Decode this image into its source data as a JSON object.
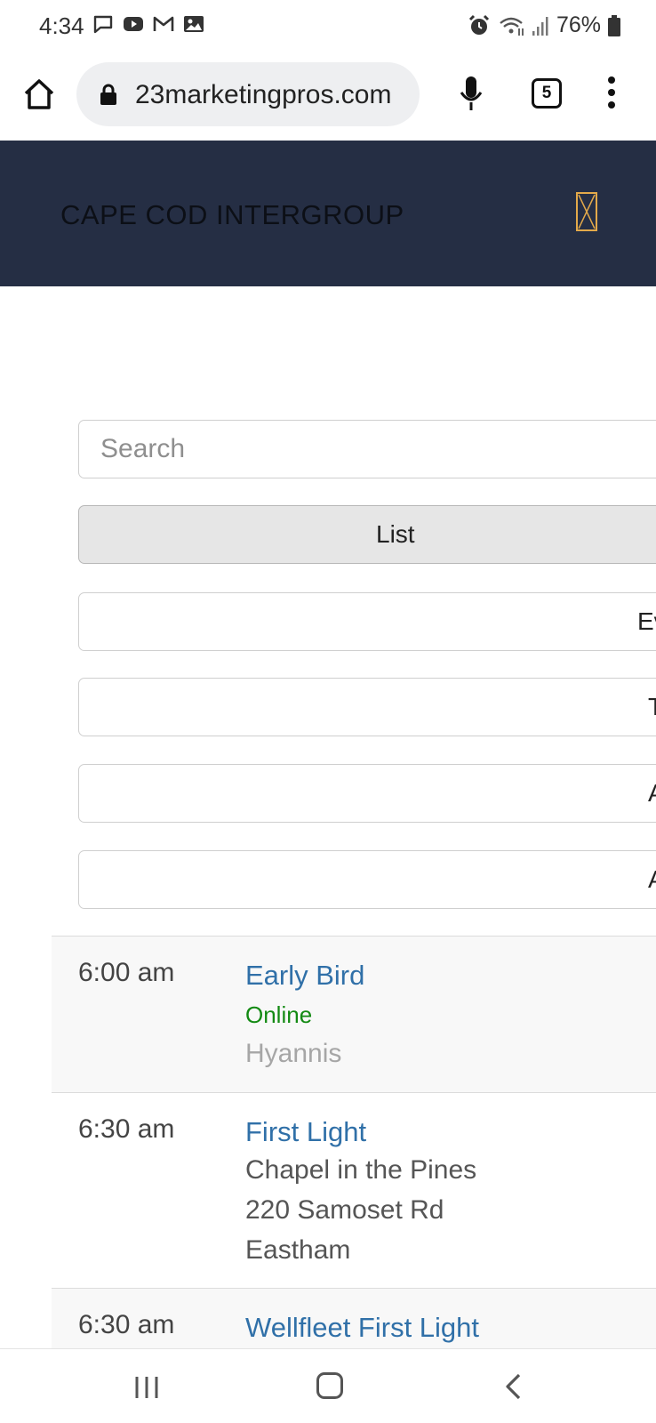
{
  "status_bar": {
    "time": "4:34",
    "battery": "76%",
    "left_icons": [
      "message-icon",
      "youtube-icon",
      "gmail-icon",
      "gallery-icon"
    ],
    "right_icons": [
      "alarm-icon",
      "wifi-icon",
      "signal-icon",
      "battery-icon"
    ]
  },
  "browser": {
    "url": "23marketingpros.com",
    "tab_count": "5"
  },
  "site": {
    "title": "CAPE COD INTERGROUP",
    "brand_color": "#252e44",
    "toggle_color": "#e3a94a"
  },
  "controls": {
    "search_placeholder": "Search",
    "list_label": "List",
    "dropdowns": [
      "Ev",
      "T",
      "A",
      "A"
    ]
  },
  "meetings": [
    {
      "time": "6:00 am",
      "name": "Early Bird",
      "online": "Online",
      "region": "Hyannis"
    },
    {
      "time": "6:30 am",
      "name": "First Light",
      "location": "Chapel in the Pines",
      "address": "220 Samoset Rd",
      "region": "Eastham"
    },
    {
      "time": "6:30 am",
      "name": "Wellfleet First Light"
    }
  ],
  "colors": {
    "link": "#3070a8",
    "online": "#138a13",
    "region": "#a6a6a6"
  }
}
